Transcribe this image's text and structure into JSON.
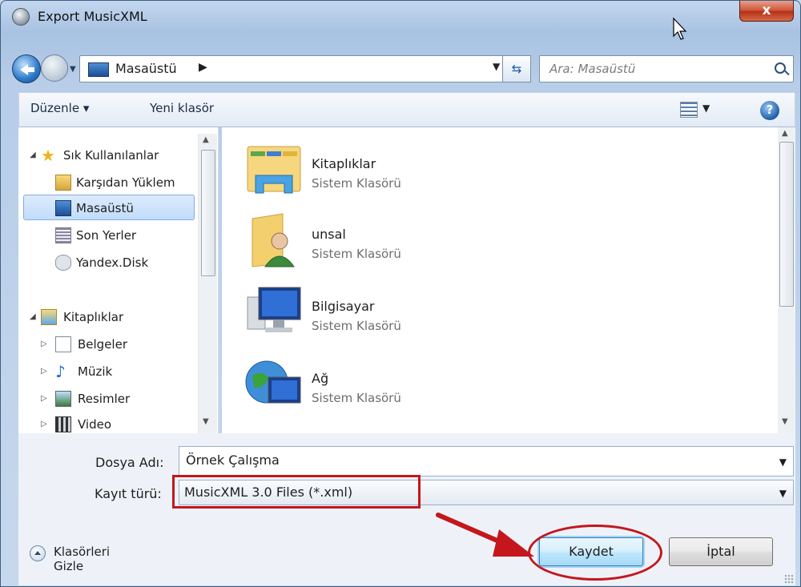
{
  "window": {
    "title": "Export MusicXML",
    "close_label": "x"
  },
  "nav": {
    "location": "Masaüstü",
    "search_placeholder": "Ara: Masaüstü"
  },
  "toolbar": {
    "organize_label": "Düzenle ▾",
    "new_folder_label": "Yeni klasör",
    "help_label": "?"
  },
  "sidebar": {
    "items": [
      {
        "label": "Sık Kullanılanlar"
      },
      {
        "label": "Karşıdan Yüklem"
      },
      {
        "label": "Masaüstü"
      },
      {
        "label": "Son Yerler"
      },
      {
        "label": "Yandex.Disk"
      },
      {
        "label": "Kitaplıklar"
      },
      {
        "label": "Belgeler"
      },
      {
        "label": "Müzik"
      },
      {
        "label": "Resimler"
      },
      {
        "label": "Video"
      }
    ]
  },
  "files": [
    {
      "name": "Kitaplıklar",
      "type": "Sistem Klasörü"
    },
    {
      "name": "unsal",
      "type": "Sistem Klasörü"
    },
    {
      "name": "Bilgisayar",
      "type": "Sistem Klasörü"
    },
    {
      "name": "Ağ",
      "type": "Sistem Klasörü"
    }
  ],
  "form": {
    "filename_label": "Dosya Adı:",
    "filename_value": "Örnek Çalışma",
    "filetype_label": "Kayıt türü:",
    "filetype_value": "MusicXML 3.0 Files (*.xml)"
  },
  "actions": {
    "hide_folders_label": "Klasörleri Gizle",
    "save_label": "Kaydet",
    "cancel_label": "İptal"
  },
  "colors": {
    "accent": "#c4161c",
    "selection": "#c1dcfb"
  }
}
